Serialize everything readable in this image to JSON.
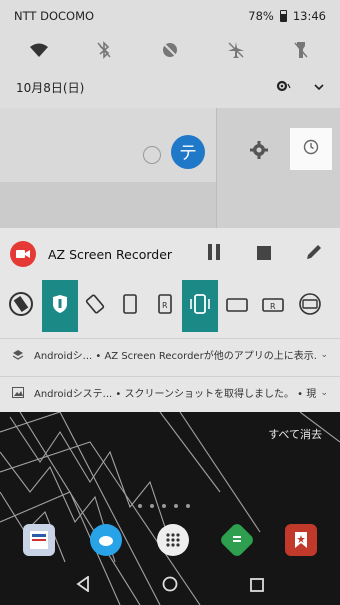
{
  "status_bar": {
    "carrier": "NTT DOCOMO",
    "battery": "78%",
    "time": "13:46"
  },
  "quick_settings": {
    "date": "10月8日(日)"
  },
  "notifications": {
    "recorder_title": "AZ Screen Recorder",
    "overlay_notice": "Androidシ... • AZ Screen Recorderが他のアプリの上に表示...",
    "screenshot_notice": "Androidシステ... • スクリーンショットを取得しました。 • 現在",
    "clear_all": "すべて消去"
  },
  "avatar_letter": "テ",
  "colors": {
    "teal_active": "#1b8a87",
    "avatar_blue": "#1f78c8",
    "recorder_red": "#e53935"
  }
}
